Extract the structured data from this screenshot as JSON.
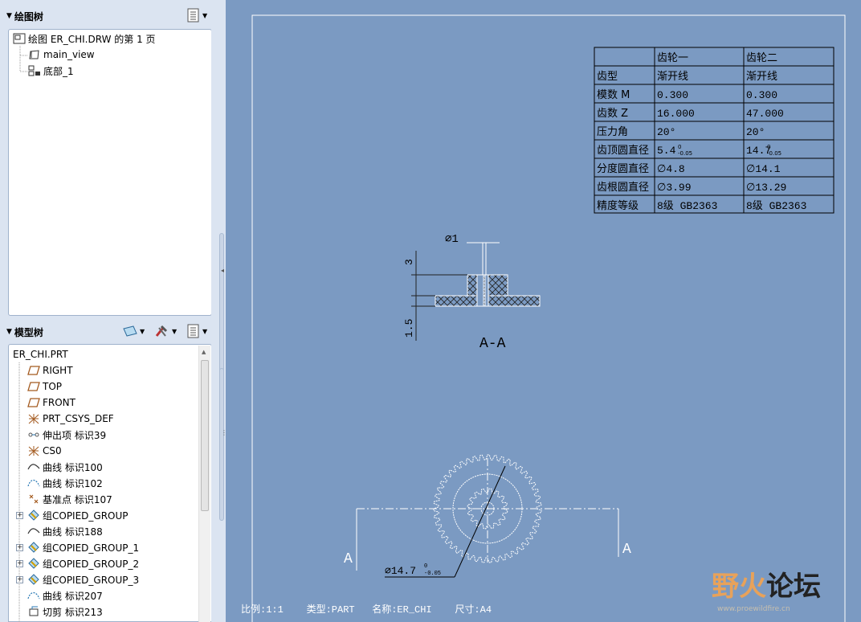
{
  "drawing_tree": {
    "title": "绘图树",
    "items": [
      {
        "label": "绘图 ER_CHI.DRW 的第 1 页",
        "icon": "drawing-sheet-icon"
      },
      {
        "label": "main_view",
        "icon": "view-icon"
      },
      {
        "label": "底部_1",
        "icon": "section-view-icon"
      }
    ]
  },
  "model_tree": {
    "title": "模型树",
    "root": "ER_CHI.PRT",
    "items": [
      {
        "label": "RIGHT",
        "icon": "datum-plane-icon"
      },
      {
        "label": "TOP",
        "icon": "datum-plane-icon"
      },
      {
        "label": "FRONT",
        "icon": "datum-plane-icon"
      },
      {
        "label": "PRT_CSYS_DEF",
        "icon": "csys-icon"
      },
      {
        "label": "伸出项 标识39",
        "icon": "protrusion-icon"
      },
      {
        "label": "CS0",
        "icon": "csys-icon"
      },
      {
        "label": "曲线 标识100",
        "icon": "curve-icon"
      },
      {
        "label": "曲线 标识102",
        "icon": "curve-dashed-icon"
      },
      {
        "label": "基准点 标识107",
        "icon": "datum-point-icon"
      },
      {
        "label": "组COPIED_GROUP",
        "icon": "group-icon"
      },
      {
        "label": "曲线 标识188",
        "icon": "curve-icon"
      },
      {
        "label": "组COPIED_GROUP_1",
        "icon": "group-icon"
      },
      {
        "label": "组COPIED_GROUP_2",
        "icon": "group-icon"
      },
      {
        "label": "组COPIED_GROUP_3",
        "icon": "group-icon"
      },
      {
        "label": "曲线 标识207",
        "icon": "curve-dashed-icon"
      },
      {
        "label": "切剪 标识213",
        "icon": "cut-icon"
      }
    ]
  },
  "gear_table": {
    "headers": [
      "",
      "齿轮一",
      "齿轮二"
    ],
    "rows": [
      [
        "齿型",
        "渐开线",
        "渐开线"
      ],
      [
        "模数    M",
        "0.300",
        "0.300"
      ],
      [
        "齿数    Z",
        "16.000",
        "47.000"
      ],
      [
        "压力角",
        "20°",
        "20°"
      ],
      [
        "齿顶圆直径",
        "5.4",
        "14.7"
      ],
      [
        "分度圆直径",
        "∅4.8",
        "∅14.1"
      ],
      [
        "齿根圆直径",
        "∅3.99",
        "∅13.29"
      ],
      [
        "精度等级",
        "8级    GB2363",
        "8级    GB2363"
      ]
    ],
    "tol_upper": "0",
    "tol_lower": "-0.05"
  },
  "section": {
    "label": "A-A",
    "dim_width": "∅1",
    "dim_height_top": "3",
    "dim_height_bottom": "1.5"
  },
  "front_view": {
    "label_left": "A",
    "label_right": "A",
    "dim_outer": "∅14.7",
    "tol_upper": "0",
    "tol_lower": "-0.05"
  },
  "footer": {
    "text": "比例:1:1    类型:PART   名称:ER_CHI    尺寸:A4"
  },
  "watermark": {
    "text_a": "野火",
    "text_b": "论坛",
    "url": "www.proewildfire.cn"
  },
  "colors": {
    "canvas": "#7b9ac2",
    "panel_bg": "#dbe4f1"
  }
}
